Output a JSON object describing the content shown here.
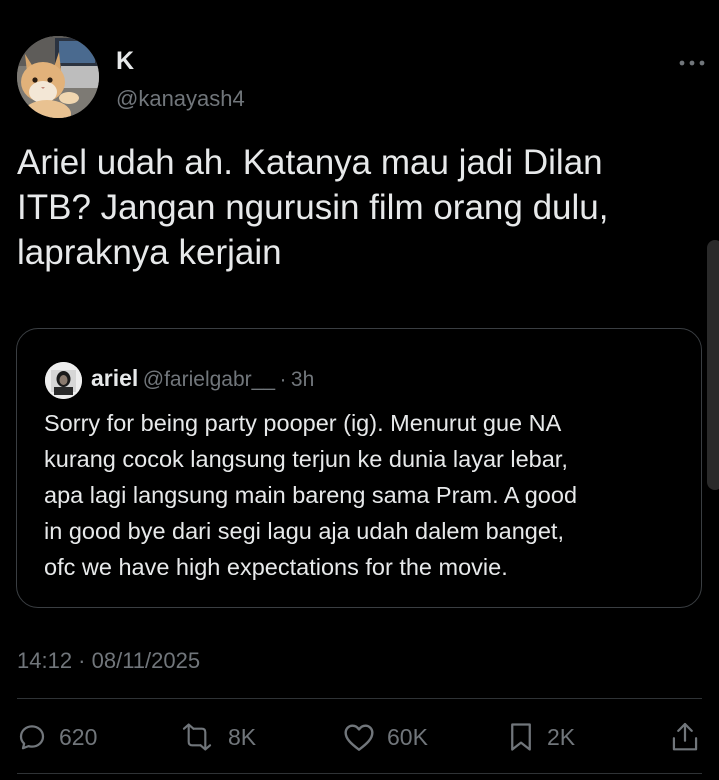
{
  "author": {
    "name": "K",
    "handle": "@kanayash4"
  },
  "tweet": {
    "text": "Ariel udah ah. Katanya mau jadi Dilan\nITB? Jangan ngurusin film orang dulu,\nlapraknya kerjain",
    "timestamp": "14:12 · 08/11/2025"
  },
  "quote": {
    "name": "ariel",
    "handle": "@farielgabr__",
    "separator": "·",
    "time": "3h",
    "text": "Sorry for being party pooper (ig). Menurut gue NA\nkurang cocok langsung terjun ke dunia layar lebar,\napa lagi langsung main bareng sama Pram. A good\nin good bye dari segi lagu aja udah dalem banget,\nofc we have high expectations for the movie."
  },
  "actions": {
    "replies": "620",
    "reposts": "8K",
    "likes": "60K",
    "bookmarks": "2K"
  },
  "icons": {
    "more": "more-horizontal-icon",
    "reply": "reply-icon",
    "repost": "repost-icon",
    "like": "heart-icon",
    "bookmark": "bookmark-icon",
    "share": "share-icon"
  },
  "colors": {
    "background": "#000000",
    "primary_text": "#e7e9ea",
    "secondary_text": "#71767b",
    "border": "#3a3e42"
  }
}
